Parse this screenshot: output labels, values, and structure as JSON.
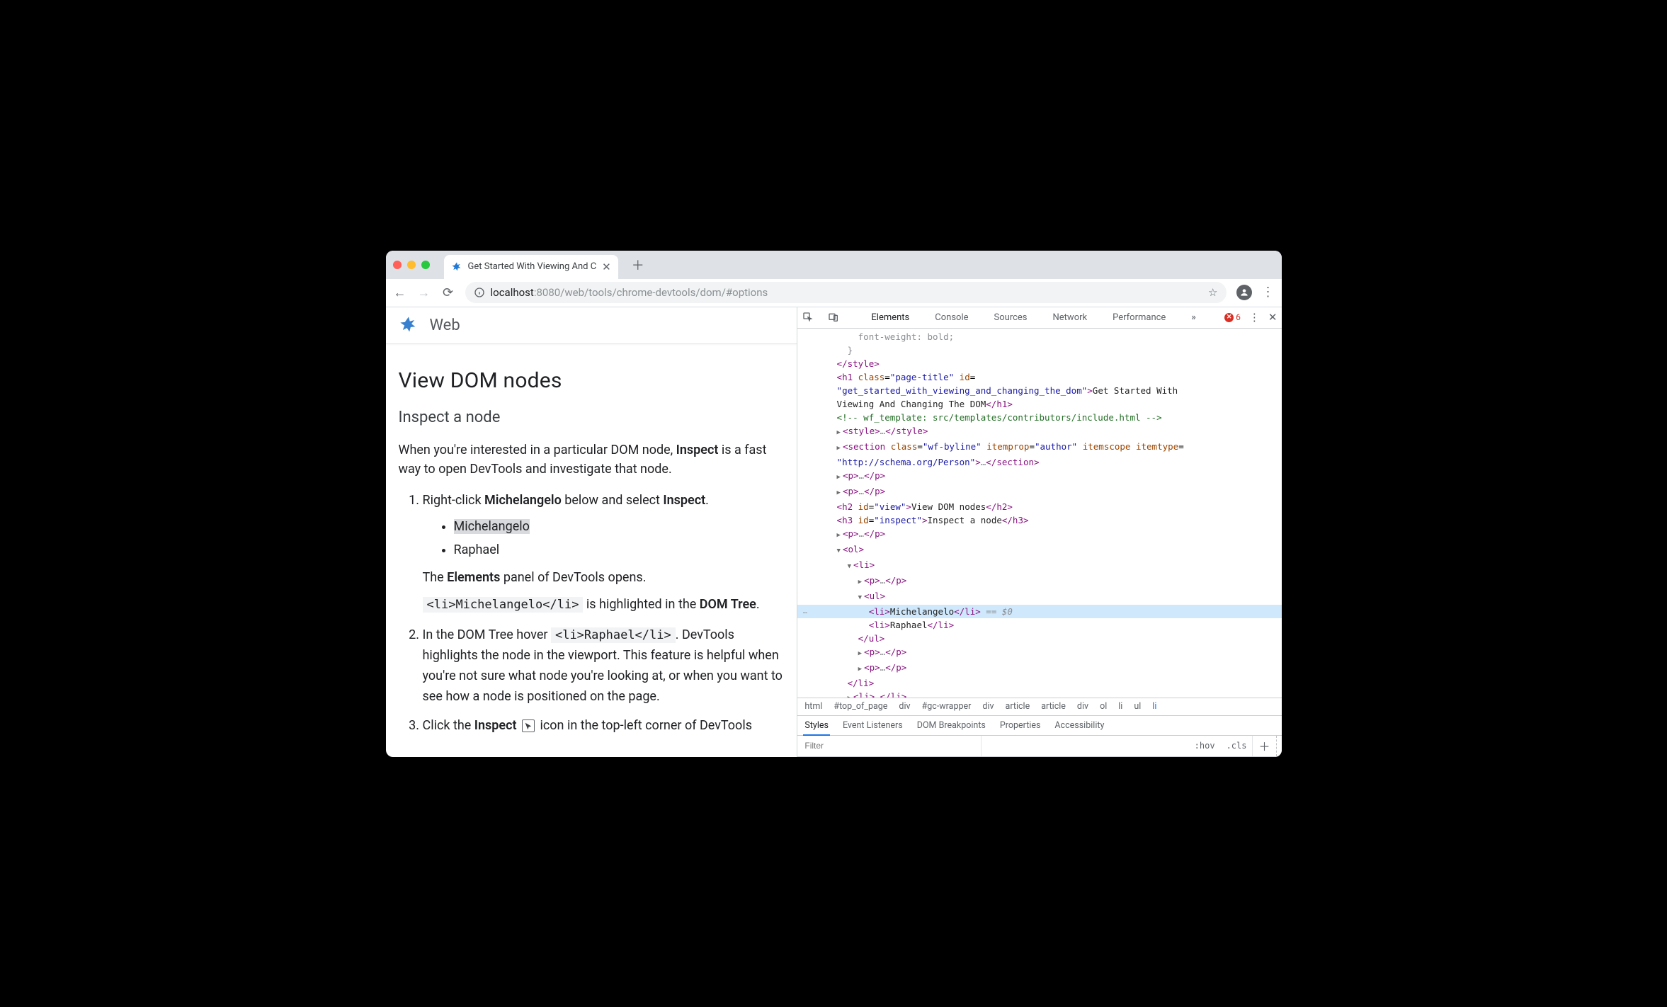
{
  "browser": {
    "tab_title": "Get Started With Viewing And C",
    "url_prefix": "localhost",
    "url_dim": ":8080/web/tools/chrome-devtools/dom/#options"
  },
  "page": {
    "site_label": "Web",
    "h1": "View DOM nodes",
    "h2": "Inspect a node",
    "intro_p_before": "When you're interested in a particular DOM node, ",
    "intro_p_strong": "Inspect",
    "intro_p_after": " is a fast way to open DevTools and investigate that node.",
    "step1_a": "Right-click ",
    "step1_strong": "Michelangelo",
    "step1_b": " below and select ",
    "step1_strong2": "Inspect",
    "step1_c": ".",
    "bullet1": "Michelangelo",
    "bullet2": "Raphael",
    "elements_sentence_a": "The ",
    "elements_sentence_strong": "Elements",
    "elements_sentence_b": " panel of DevTools opens.",
    "code1": "<li>Michelangelo</li>",
    "code1_after_a": " is highlighted in the ",
    "code1_after_strong": "DOM Tree",
    "code1_after_b": ".",
    "step2_a": "In the DOM Tree hover ",
    "step2_code": "<li>Raphael</li>",
    "step2_b": ". DevTools highlights the node in the viewport. This feature is helpful when you're not sure what node you're looking at, or when you want to see how a node is positioned on the page.",
    "step3_a": "Click the ",
    "step3_strong": "Inspect",
    "step3_b": " icon in the top-left corner of DevTools"
  },
  "devtools": {
    "tabs": [
      "Elements",
      "Console",
      "Sources",
      "Network",
      "Performance"
    ],
    "active_tab": "Elements",
    "error_count": "6",
    "dom_lines": [
      {
        "indent": 10,
        "html": "<span class='k-dim'>font-weight: bold;</span>"
      },
      {
        "indent": 8,
        "html": "<span class='k-dim'>}</span>"
      },
      {
        "indent": 6,
        "html": "<span class='k-tag'>&lt;/style&gt;</span>"
      },
      {
        "indent": 6,
        "html": "<span class='k-tag'>&lt;h1</span> <span class='k-attr'>class</span>=<span class='k-str'>\"page-title\"</span> <span class='k-attr'>id</span>="
      },
      {
        "indent": 6,
        "html": "<span class='k-str'>\"get_started_with_viewing_and_changing_the_dom\"</span><span class='k-tag'>&gt;</span><span class='k-text'>Get Started With</span>"
      },
      {
        "indent": 6,
        "html": "<span class='k-text'>Viewing And Changing The DOM</span><span class='k-tag'>&lt;/h1&gt;</span>"
      },
      {
        "indent": 6,
        "html": "<span class='k-cmt'>&lt;!-- wf_template: src/templates/contributors/include.html --&gt;</span>"
      },
      {
        "indent": 6,
        "caret": "closed",
        "html": "<span class='k-tag'>&lt;style&gt;</span><span class='k-dim'>…</span><span class='k-tag'>&lt;/style&gt;</span>"
      },
      {
        "indent": 6,
        "caret": "closed",
        "html": "<span class='k-tag'>&lt;section</span> <span class='k-attr'>class</span>=<span class='k-str'>\"wf-byline\"</span> <span class='k-attr'>itemprop</span>=<span class='k-str'>\"author\"</span> <span class='k-attr'>itemscope</span> <span class='k-attr'>itemtype</span>="
      },
      {
        "indent": 6,
        "html": "<span class='k-str'>\"http://schema.org/Person\"</span><span class='k-tag'>&gt;</span><span class='k-dim'>…</span><span class='k-tag'>&lt;/section&gt;</span>"
      },
      {
        "indent": 6,
        "caret": "closed",
        "html": "<span class='k-tag'>&lt;p&gt;</span><span class='k-dim'>…</span><span class='k-tag'>&lt;/p&gt;</span>"
      },
      {
        "indent": 6,
        "caret": "closed",
        "html": "<span class='k-tag'>&lt;p&gt;</span><span class='k-dim'>…</span><span class='k-tag'>&lt;/p&gt;</span>"
      },
      {
        "indent": 6,
        "html": "<span class='k-tag'>&lt;h2</span> <span class='k-attr'>id</span>=<span class='k-str'>\"view\"</span><span class='k-tag'>&gt;</span><span class='k-text'>View DOM nodes</span><span class='k-tag'>&lt;/h2&gt;</span>"
      },
      {
        "indent": 6,
        "html": "<span class='k-tag'>&lt;h3</span> <span class='k-attr'>id</span>=<span class='k-str'>\"inspect\"</span><span class='k-tag'>&gt;</span><span class='k-text'>Inspect a node</span><span class='k-tag'>&lt;/h3&gt;</span>"
      },
      {
        "indent": 6,
        "caret": "closed",
        "html": "<span class='k-tag'>&lt;p&gt;</span><span class='k-dim'>…</span><span class='k-tag'>&lt;/p&gt;</span>"
      },
      {
        "indent": 6,
        "caret": "open",
        "html": "<span class='k-tag'>&lt;ol&gt;</span>"
      },
      {
        "indent": 8,
        "caret": "open",
        "html": "<span class='k-tag'>&lt;li&gt;</span>"
      },
      {
        "indent": 10,
        "caret": "closed",
        "html": "<span class='k-tag'>&lt;p&gt;</span><span class='k-dim'>…</span><span class='k-tag'>&lt;/p&gt;</span>"
      },
      {
        "indent": 10,
        "caret": "open",
        "html": "<span class='k-tag'>&lt;ul&gt;</span>"
      },
      {
        "indent": 12,
        "selected": true,
        "html": "<span class='k-tag'>&lt;li&gt;</span><span class='k-text'>Michelangelo</span><span class='k-tag'>&lt;/li&gt;</span> <span class='k-eqs'>== $0</span>"
      },
      {
        "indent": 12,
        "html": "<span class='k-tag'>&lt;li&gt;</span><span class='k-text'>Raphael</span><span class='k-tag'>&lt;/li&gt;</span>"
      },
      {
        "indent": 10,
        "html": "<span class='k-tag'>&lt;/ul&gt;</span>"
      },
      {
        "indent": 10,
        "caret": "closed",
        "html": "<span class='k-tag'>&lt;p&gt;</span><span class='k-dim'>…</span><span class='k-tag'>&lt;/p&gt;</span>"
      },
      {
        "indent": 10,
        "caret": "closed",
        "html": "<span class='k-tag'>&lt;p&gt;</span><span class='k-dim'>…</span><span class='k-tag'>&lt;/p&gt;</span>"
      },
      {
        "indent": 8,
        "html": "<span class='k-tag'>&lt;/li&gt;</span>"
      },
      {
        "indent": 8,
        "caret": "closed",
        "html": "<span class='k-tag'>&lt;li&gt;</span><span class='k-dim'>…</span><span class='k-tag'>&lt;/li&gt;</span>"
      }
    ],
    "crumbs": [
      "html",
      "#top_of_page",
      "div",
      "#gc-wrapper",
      "div",
      "article",
      "article",
      "div",
      "ol",
      "li",
      "ul",
      "li"
    ],
    "subtabs": [
      "Styles",
      "Event Listeners",
      "DOM Breakpoints",
      "Properties",
      "Accessibility"
    ],
    "active_subtab": "Styles",
    "filter_placeholder": "Filter",
    "hov": ":hov",
    "cls": ".cls"
  }
}
